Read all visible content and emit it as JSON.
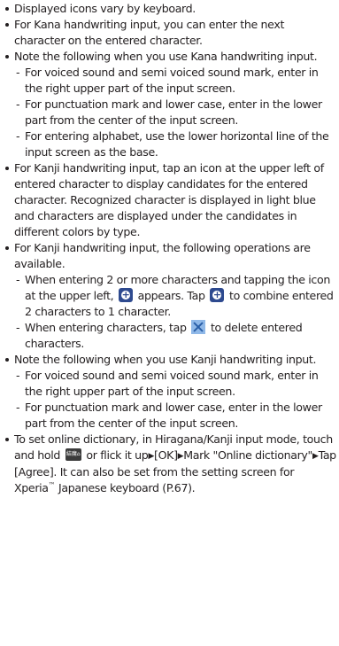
{
  "bullets": {
    "b1": "Displayed icons vary by keyboard.",
    "b2": "For Kana handwriting input, you can enter the next character on the entered character.",
    "b3": "Note the following when you use Kana handwriting input.",
    "b3_subs": [
      "For voiced sound and semi voiced sound mark, enter in the right upper part of the input screen.",
      "For punctuation mark and lower case, enter in the lower part from the center of the input screen.",
      "For entering alphabet, use the lower horizontal line of the input screen as the base."
    ],
    "b4": "For Kanji handwriting input, tap an icon at the upper left of entered character to display candidates for the entered character. Recognized character is displayed in light blue and characters are displayed under the candidates in different colors by type.",
    "b5": "For Kanji handwriting input, the following operations are available.",
    "b5_sub1_a": "When entering 2 or more characters and tapping the icon at the upper left,",
    "b5_sub1_b": "appears. Tap",
    "b5_sub1_c": "to combine entered 2 characters to 1 character.",
    "b5_sub2_a": "When entering characters, tap",
    "b5_sub2_b": "to delete entered characters.",
    "b6": "Note the following when you use Kanji handwriting input.",
    "b6_subs": [
      "For voiced sound and semi voiced sound mark, enter in the right upper part of the input screen.",
      "For punctuation mark and lower case, enter in the lower part from the center of the input screen."
    ],
    "b7_a": "To set online dictionary, in Hiragana/Kanji input mode, touch and hold",
    "b7_b": "or flick it up",
    "b7_c": "[OK]",
    "b7_d": "Mark \"Online dictionary\"",
    "b7_e": "Tap [Agree]. It can also be set from the setting screen for Xperia",
    "b7_tm": "™",
    "b7_f": " Japanese keyboard (P.67).",
    "arrow_glyph": "▶",
    "key_icon_text": "結魔⌂"
  },
  "icons": {
    "combine": "combine-plus-icon",
    "delete": "delete-x-icon",
    "key": "keyboard-key-icon"
  },
  "colors": {
    "text": "#231f20",
    "icon_blue": "#2e4a8f",
    "delete_bg": "#8fb8e8"
  }
}
